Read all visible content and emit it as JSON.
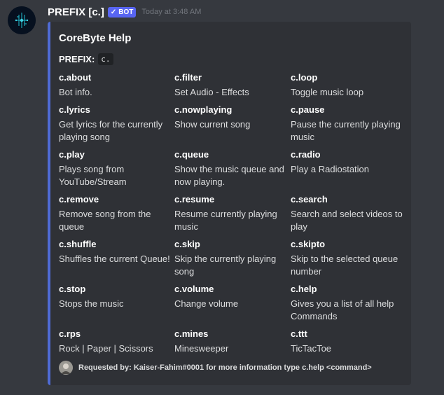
{
  "message": {
    "username": "PREFIX [c.]",
    "bot_tag": "BOT",
    "timestamp": "Today at 3:48 AM"
  },
  "embed": {
    "accent_color": "#4f6bd5",
    "title": "CoreByte Help",
    "prefix_label": "PREFIX:",
    "prefix_value": "c.",
    "fields": [
      {
        "name": "c.about",
        "value": "Bot info."
      },
      {
        "name": "c.filter",
        "value": "Set Audio - Effects"
      },
      {
        "name": "c.loop",
        "value": "Toggle music loop"
      },
      {
        "name": "c.lyrics",
        "value": "Get lyrics for the currently playing song"
      },
      {
        "name": "c.nowplaying",
        "value": "Show current song"
      },
      {
        "name": "c.pause",
        "value": "Pause the currently playing music"
      },
      {
        "name": "c.play",
        "value": "Plays song from YouTube/Stream"
      },
      {
        "name": "c.queue",
        "value": "Show the music queue and now playing."
      },
      {
        "name": "c.radio",
        "value": "Play a Radiostation"
      },
      {
        "name": "c.remove",
        "value": "Remove song from the queue"
      },
      {
        "name": "c.resume",
        "value": "Resume currently playing music"
      },
      {
        "name": "c.search",
        "value": "Search and select videos to play"
      },
      {
        "name": "c.shuffle",
        "value": "Shuffles the current Queue!"
      },
      {
        "name": "c.skip",
        "value": "Skip the currently playing song"
      },
      {
        "name": "c.skipto",
        "value": "Skip to the selected queue number"
      },
      {
        "name": "c.stop",
        "value": "Stops the music"
      },
      {
        "name": "c.volume",
        "value": "Change volume"
      },
      {
        "name": "c.help",
        "value": "Gives you a list of all help Commands"
      },
      {
        "name": "c.rps",
        "value": "Rock | Paper | Scissors"
      },
      {
        "name": "c.mines",
        "value": "Minesweeper"
      },
      {
        "name": "c.ttt",
        "value": "TicTacToe"
      }
    ],
    "footer": "Requested by: Kaiser-Fahim#0001 for more information type c.help <command>"
  }
}
